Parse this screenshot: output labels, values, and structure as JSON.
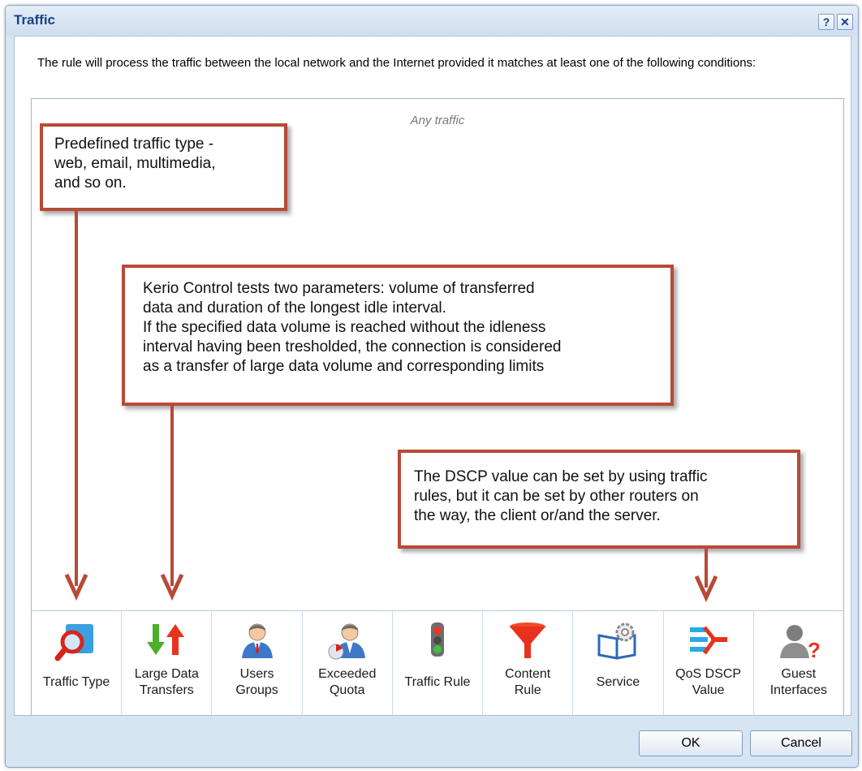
{
  "window": {
    "title": "Traffic",
    "help_label": "?",
    "close_label": "✕"
  },
  "intro_text": "The rule will process the traffic between the local network and the Internet provided it matches at least one of the following conditions:",
  "any_traffic": "Any traffic",
  "callouts": {
    "traffic_type": [
      "Predefined traffic type -",
      "web, email, multimedia,",
      "and so on."
    ],
    "large_data": [
      "Kerio Control tests two parameters: volume of transferred",
      "data and duration of the longest idle interval.",
      "If the specified data volume is reached without  the idleness",
      "interval having been tresholded, the connection is considered",
      "as a transfer of large data volume and corresponding limits"
    ],
    "dscp": [
      "The DSCP value can be set by using traffic",
      "rules, but it can be set by other routers on",
      "the way, the client or/and the server."
    ]
  },
  "conditions": [
    {
      "line1": "Traffic Type",
      "line2": "",
      "icon": "traffic-type-icon"
    },
    {
      "line1": "Large Data",
      "line2": "Transfers",
      "icon": "large-data-transfers-icon"
    },
    {
      "line1": "Users",
      "line2": "Groups",
      "icon": "users-groups-icon"
    },
    {
      "line1": "Exceeded",
      "line2": "Quota",
      "icon": "exceeded-quota-icon"
    },
    {
      "line1": "Traffic Rule",
      "line2": "",
      "icon": "traffic-rule-icon"
    },
    {
      "line1": "Content",
      "line2": "Rule",
      "icon": "content-rule-icon"
    },
    {
      "line1": "Service",
      "line2": "",
      "icon": "service-icon"
    },
    {
      "line1": "QoS DSCP",
      "line2": "Value",
      "icon": "qos-dscp-icon"
    },
    {
      "line1": "Guest",
      "line2": "Interfaces",
      "icon": "guest-interfaces-icon"
    }
  ],
  "buttons": {
    "ok": "OK",
    "cancel": "Cancel"
  },
  "colors": {
    "callout_border": "#b84a36",
    "title_text": "#15428b"
  }
}
